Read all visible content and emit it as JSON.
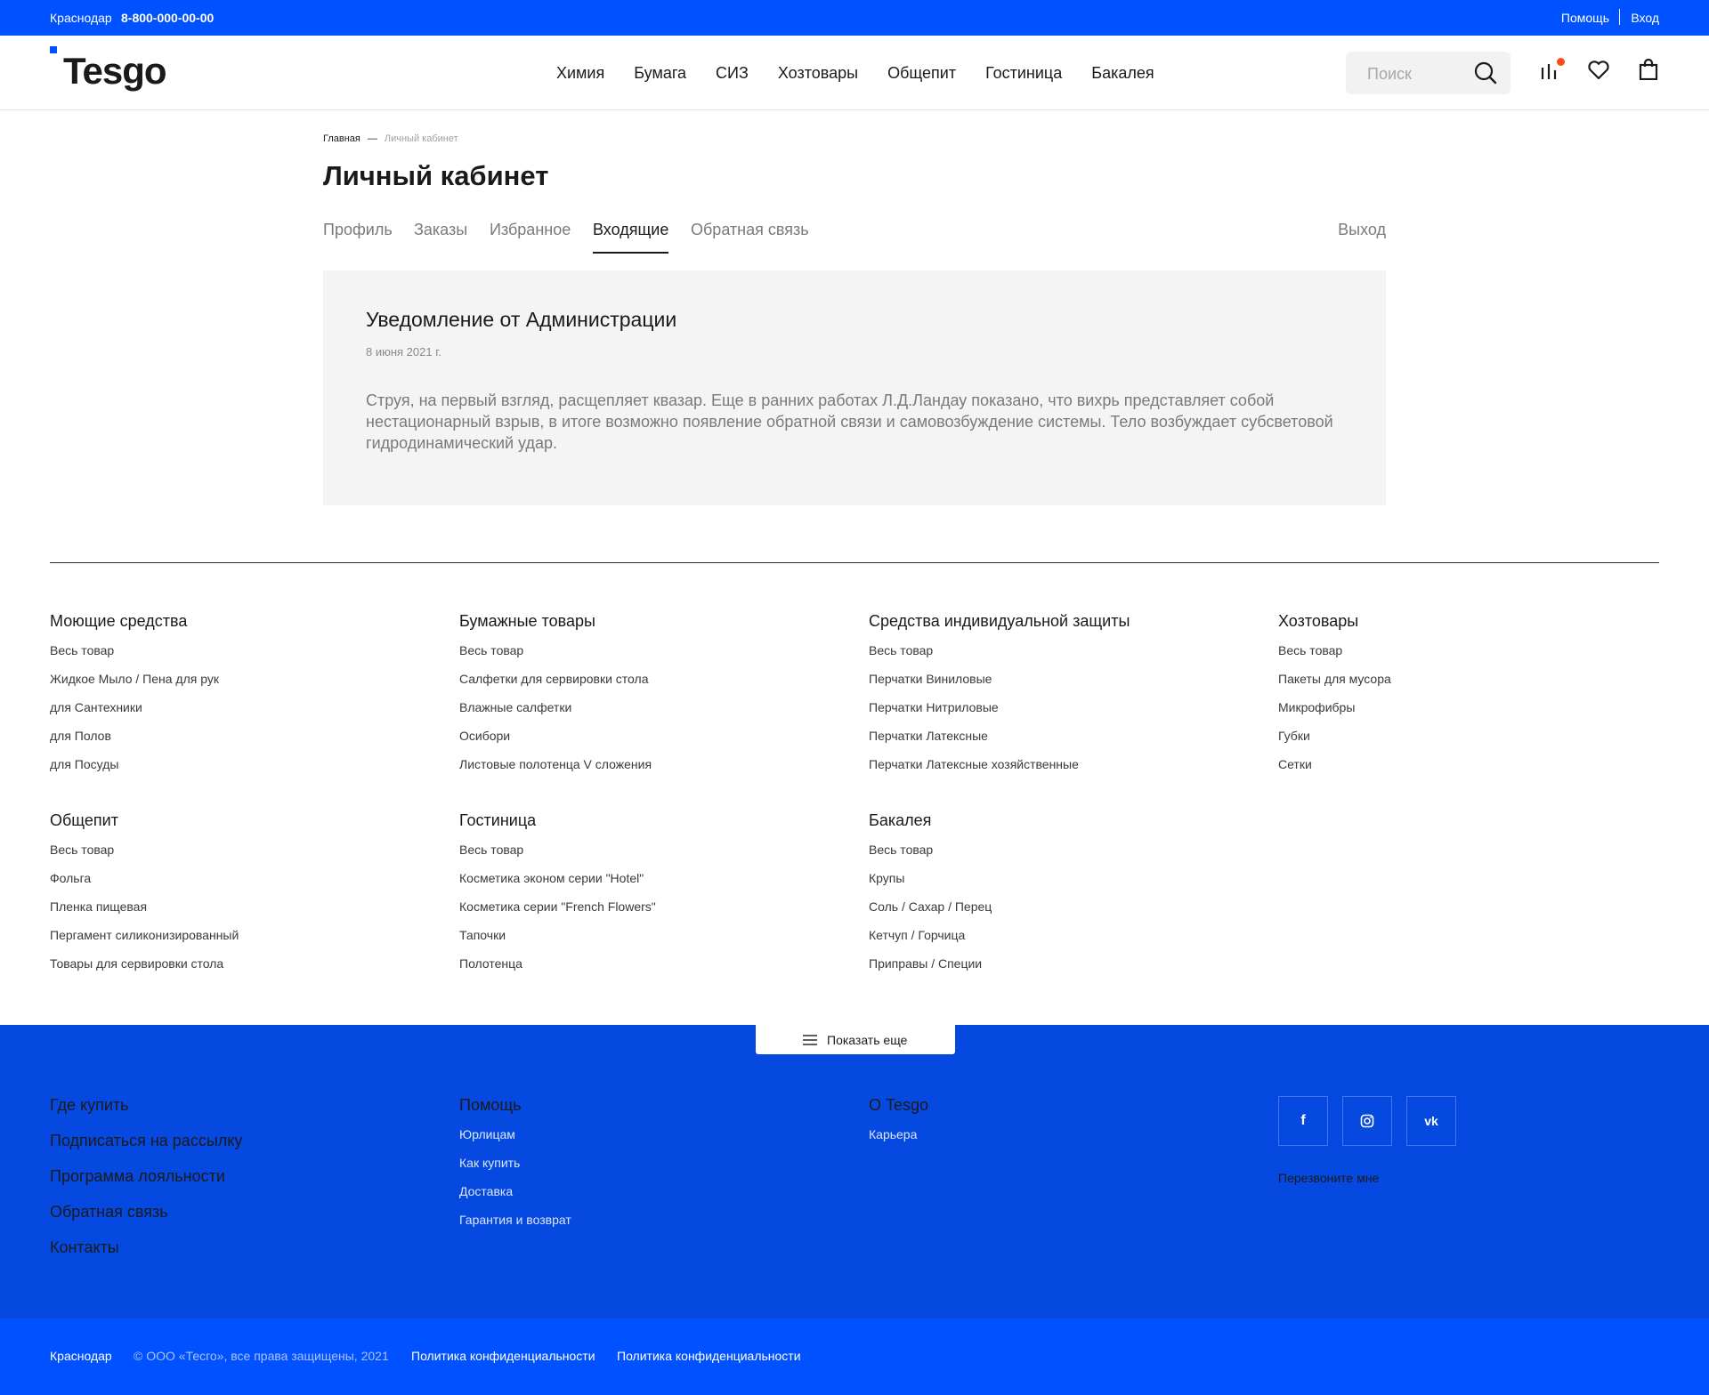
{
  "topbar": {
    "city": "Краснодар",
    "phone": "8-800-000-00-00",
    "help": "Помощь",
    "login": "Вход"
  },
  "header": {
    "logo": "Tesgo",
    "nav": [
      "Химия",
      "Бумага",
      "СИЗ",
      "Хозтовары",
      "Общепит",
      "Гостиница",
      "Бакалея"
    ],
    "search_placeholder": "Поиск",
    "icons": [
      "compare-icon",
      "heart-icon",
      "bag-icon"
    ],
    "accent_color": "#0051ff",
    "badge_color": "#ff4c1a"
  },
  "breadcrumb": {
    "home": "Главная",
    "separator": "—",
    "current": "Личный кабинет"
  },
  "page": {
    "title": "Личный кабинет",
    "tabs": [
      "Профиль",
      "Заказы",
      "Избранное",
      "Входящие",
      "Обратная связь"
    ],
    "active_tab": "Входящие",
    "logout": "Выход"
  },
  "message": {
    "title": "Уведомление от Администрации",
    "date": "8 июня 2021 г.",
    "body": "Струя, на первый взгляд, расщепляет квазар. Еще в ранних работах Л.Д.Ландау показано, что вихрь представляет собой нестационарный взрыв, в итоге возможно появление обратной связи и самовозбуждение системы. Тело возбуждает субсветовой гидродинамический удар."
  },
  "catalog": [
    {
      "title": "Моющие средства",
      "items": [
        "Весь товар",
        "Жидкое Мыло / Пена для рук",
        "для Сантехники",
        "для Полов",
        "для Посуды"
      ]
    },
    {
      "title": "Бумажные товары",
      "items": [
        "Весь товар",
        "Салфетки для сервировки стола",
        "Влажные салфетки",
        "Осибори",
        "Листовые полотенца V сложения"
      ]
    },
    {
      "title": "Средства индивидуальной защиты",
      "items": [
        "Весь товар",
        "Перчатки Виниловые",
        "Перчатки Нитриловые",
        "Перчатки Латексные",
        "Перчатки Латексные хозяйственные"
      ]
    },
    {
      "title": "Хозтовары",
      "items": [
        "Весь товар",
        "Пакеты для мусора",
        "Микрофибры",
        "Губки",
        "Сетки"
      ]
    },
    {
      "title": "Общепит",
      "items": [
        "Весь товар",
        "Фольга",
        "Пленка пищевая",
        "Пергамент силиконизированный",
        "Товары для сервировки стола"
      ]
    },
    {
      "title": "Гостиница",
      "items": [
        "Весь товар",
        "Косметика эконом серии \"Hotel\"",
        "Косметика серии \"French Flowers\"",
        "Тапочки",
        "Полотенца"
      ]
    },
    {
      "title": "Бакалея",
      "items": [
        "Весь товар",
        "Крупы",
        "Соль / Сахар / Перец",
        "Кетчуп / Горчица",
        "Приправы / Специи"
      ]
    }
  ],
  "show_more": "Показать еще",
  "footer": {
    "main_links": [
      "Где купить",
      "Подписаться на рассылку",
      "Программа лояльности",
      "Обратная связь",
      "Контакты"
    ],
    "help": {
      "title": "Помощь",
      "items": [
        "Юрлицам",
        "Как купить",
        "Доставка",
        "Гарантия и возврат"
      ]
    },
    "about": {
      "title": "О Tesgo",
      "items": [
        "Карьера"
      ]
    },
    "social": [
      "f",
      "◎",
      "vk"
    ],
    "call_me": "Перезвоните мне",
    "bg_color": "#0549e0"
  },
  "bottombar": {
    "city": "Краснодар",
    "copyright": "© ООО «Тесго», все права защищены, 2021",
    "policy1": "Политика конфиденциальности",
    "policy2": "Политика конфиденциальности"
  }
}
